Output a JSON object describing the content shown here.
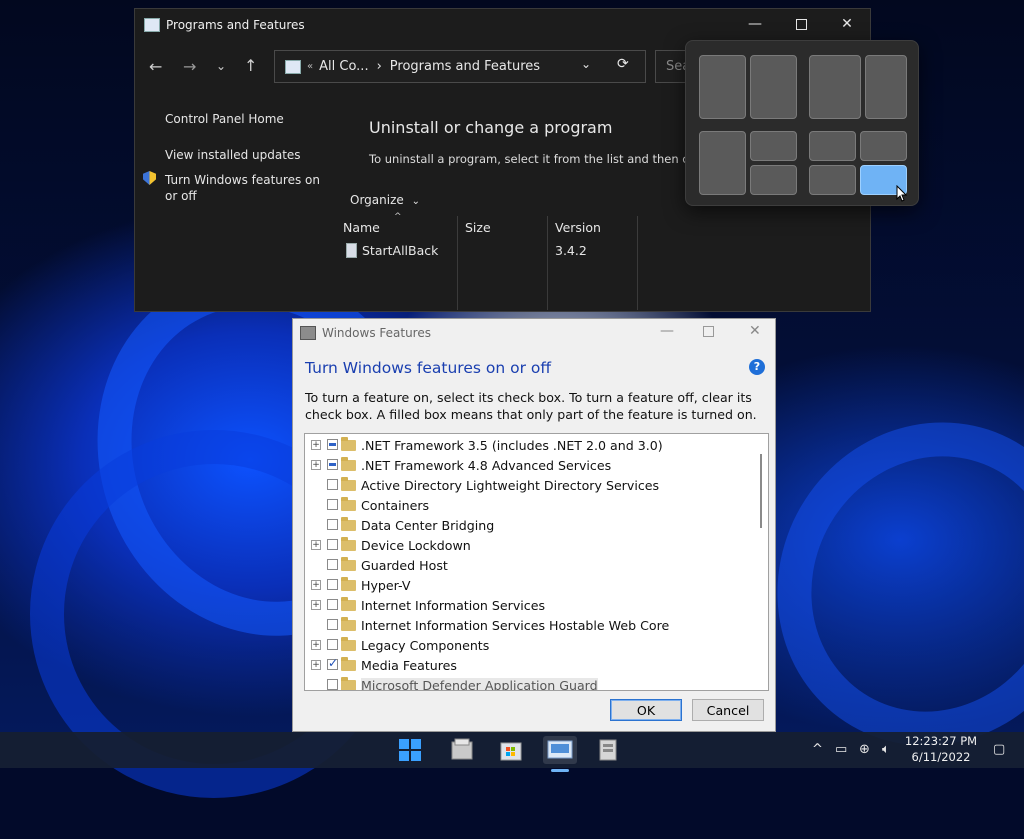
{
  "programs_window": {
    "title": "Programs and Features",
    "address": {
      "prefix": "«",
      "segment_1": "All Co...",
      "separator": "›",
      "segment_2": "Programs and Features"
    },
    "search_placeholder": "Sea",
    "sidebar": {
      "control_panel_home": "Control Panel Home",
      "view_updates": "View installed updates",
      "turn_features": "Turn Windows features on or off"
    },
    "heading": "Uninstall or change a program",
    "subtext": "To uninstall a program, select it from the list and then click",
    "organize": "Organize",
    "columns": [
      "Name",
      "Size",
      "Version"
    ],
    "rows": [
      {
        "name": "StartAllBack",
        "size": "",
        "version": "3.4.2"
      }
    ]
  },
  "snap_layouts": {
    "active_layout": 4,
    "active_zone": 4,
    "accent": "#6fb3f5"
  },
  "features_dialog": {
    "title": "Windows Features",
    "heading": "Turn Windows features on or off",
    "help": "?",
    "description": "To turn a feature on, select its check box. To turn a feature off, clear its check box. A filled box means that only part of the feature is turned on.",
    "items": [
      {
        "label": ".NET Framework 3.5 (includes .NET 2.0 and 3.0)",
        "expandable": true,
        "state": "partial"
      },
      {
        "label": ".NET Framework 4.8 Advanced Services",
        "expandable": true,
        "state": "partial"
      },
      {
        "label": "Active Directory Lightweight Directory Services",
        "expandable": false,
        "state": "unchecked"
      },
      {
        "label": "Containers",
        "expandable": false,
        "state": "unchecked"
      },
      {
        "label": "Data Center Bridging",
        "expandable": false,
        "state": "unchecked"
      },
      {
        "label": "Device Lockdown",
        "expandable": true,
        "state": "unchecked"
      },
      {
        "label": "Guarded Host",
        "expandable": false,
        "state": "unchecked"
      },
      {
        "label": "Hyper-V",
        "expandable": true,
        "state": "unchecked"
      },
      {
        "label": "Internet Information Services",
        "expandable": true,
        "state": "unchecked"
      },
      {
        "label": "Internet Information Services Hostable Web Core",
        "expandable": false,
        "state": "unchecked"
      },
      {
        "label": "Legacy Components",
        "expandable": true,
        "state": "unchecked"
      },
      {
        "label": "Media Features",
        "expandable": true,
        "state": "checked"
      },
      {
        "label": "Microsoft Defender Application Guard",
        "expandable": false,
        "state": "unchecked"
      }
    ],
    "ok_label": "OK",
    "cancel_label": "Cancel"
  },
  "taskbar": {
    "apps": [
      "start-icon",
      "file-explorer-icon",
      "microsoft-store-icon",
      "control-panel-icon",
      "windows-features-icon"
    ],
    "tray": {
      "chevron": "^",
      "time": "12:23:27 PM",
      "date": "6/11/2022"
    }
  }
}
